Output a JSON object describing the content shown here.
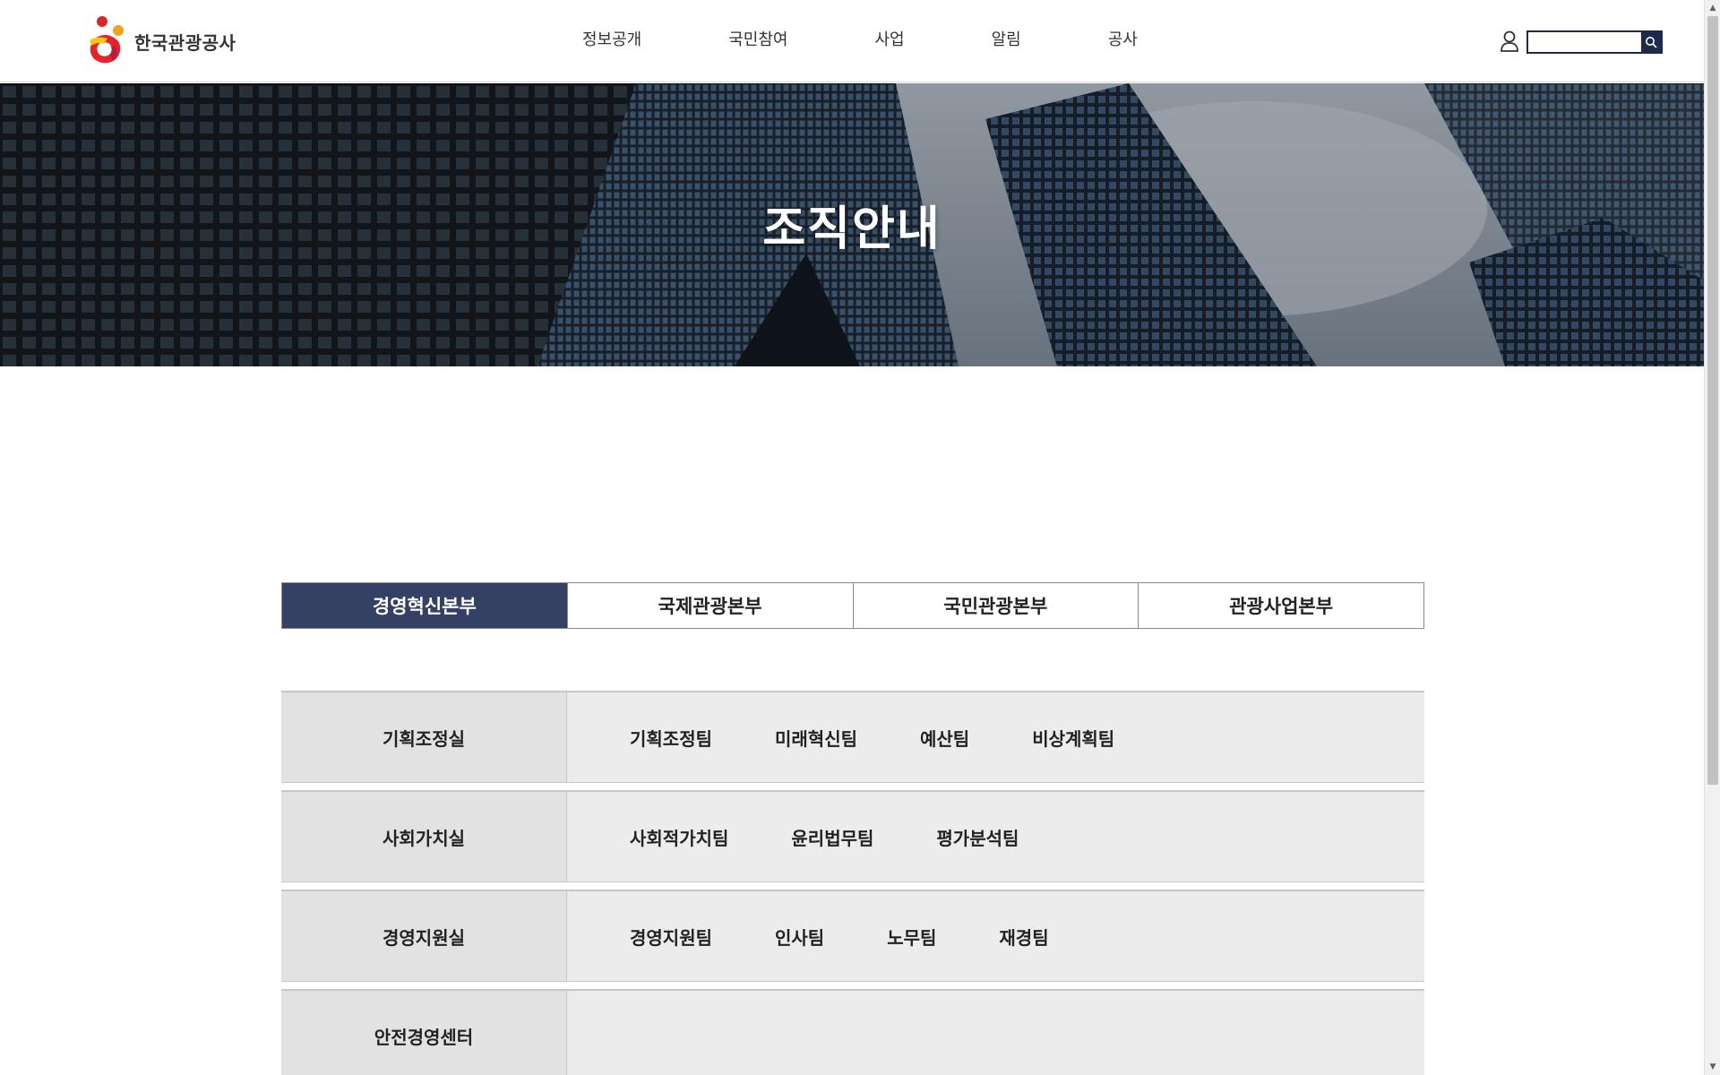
{
  "header": {
    "logo_text": "한국관광공사",
    "nav": [
      "정보공개",
      "국민참여",
      "사업",
      "알림",
      "공사"
    ],
    "search_placeholder": ""
  },
  "hero": {
    "title": "조직안내"
  },
  "tabs": [
    {
      "label": "경영혁신본부",
      "active": true
    },
    {
      "label": "국제관광본부",
      "active": false
    },
    {
      "label": "국민관광본부",
      "active": false
    },
    {
      "label": "관광사업본부",
      "active": false
    }
  ],
  "org": [
    {
      "office": "기획조정실",
      "teams": [
        "기획조정팀",
        "미래혁신팀",
        "예산팀",
        "비상계획팀"
      ]
    },
    {
      "office": "사회가치실",
      "teams": [
        "사회적가치팀",
        "윤리법무팀",
        "평가분석팀"
      ]
    },
    {
      "office": "경영지원실",
      "teams": [
        "경영지원팀",
        "인사팀",
        "노무팀",
        "재경팀"
      ]
    },
    {
      "office": "안전경영센터",
      "teams": []
    }
  ],
  "colors": {
    "active_tab": "#354164",
    "search_accent": "#1f2a4a",
    "row_bg": "#ececec",
    "head_bg": "#e2e2e2"
  },
  "icons": [
    "user-icon",
    "search-icon",
    "scroll-up-arrow-icon",
    "scroll-down-arrow-icon"
  ]
}
